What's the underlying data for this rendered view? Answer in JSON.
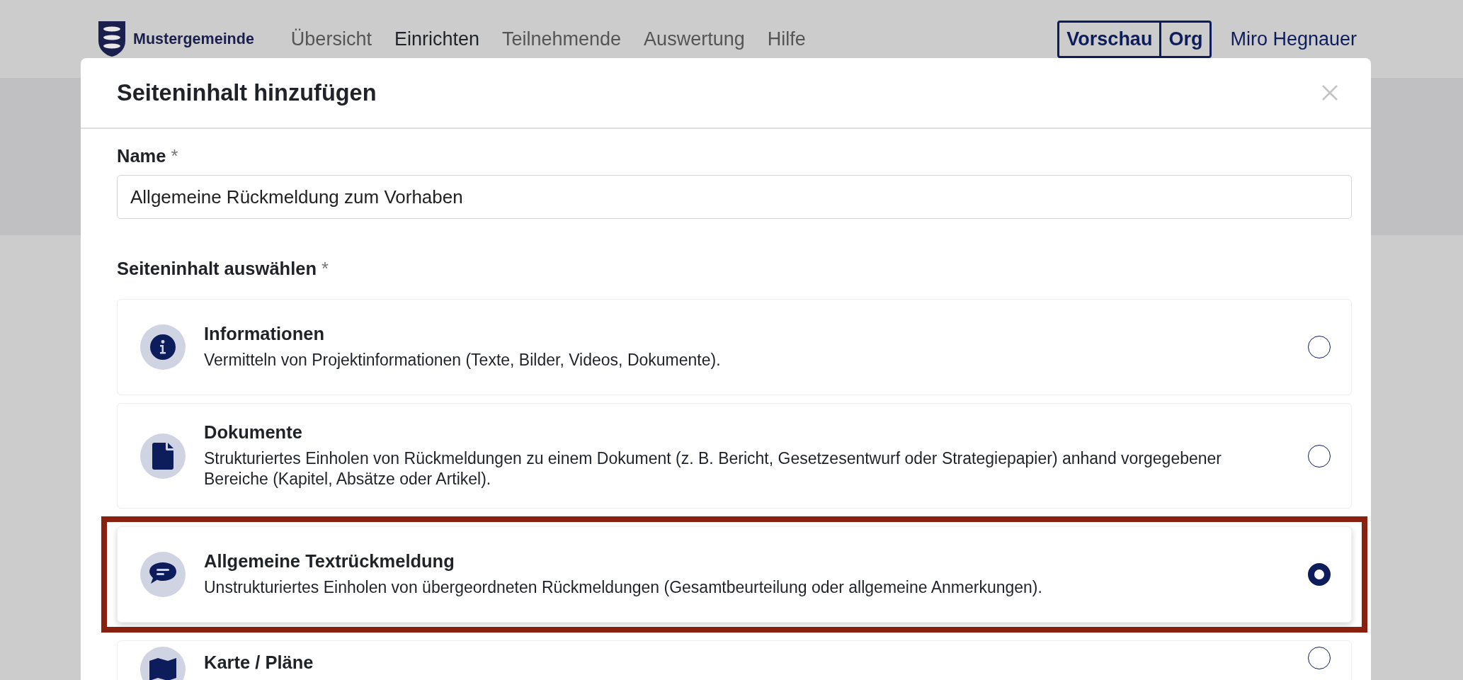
{
  "header": {
    "logo_text": "Mustergemeinde",
    "nav": [
      {
        "label": "Übersicht",
        "selected": false
      },
      {
        "label": "Einrichten",
        "selected": true
      },
      {
        "label": "Teilnehmende",
        "selected": false
      },
      {
        "label": "Auswertung",
        "selected": false
      },
      {
        "label": "Hilfe",
        "selected": false
      }
    ],
    "toggle": [
      {
        "label": "Vorschau"
      },
      {
        "label": "Org"
      }
    ],
    "user": "Miro Hegnauer"
  },
  "dialog": {
    "title": "Seiteninhalt hinzufügen",
    "name_label": "Name",
    "name_required": "*",
    "name_value": "Allgemeine Rückmeldung zum Vorhaben",
    "content_label": "Seiteninhalt auswählen",
    "content_required": "*",
    "options": [
      {
        "kind": "info",
        "title": "Informationen",
        "description": "Vermitteln von Projektinformationen (Texte, Bilder, Videos, Dokumente).",
        "selected": false,
        "highlighted": false
      },
      {
        "kind": "document",
        "title": "Dokumente",
        "description": "Strukturiertes Einholen von Rückmeldungen zu einem Dokument (z. B. Bericht, Gesetzesentwurf oder Strategiepapier) anhand vorgegebener Bereiche (Kapitel, Absätze oder Artikel).",
        "selected": false,
        "highlighted": false
      },
      {
        "kind": "comment",
        "title": "Allgemeine Textrückmeldung",
        "description": "Unstrukturiertes Einholen von übergeordneten Rückmeldungen (Gesamtbeurteilung oder allgemeine Anmerkungen).",
        "selected": true,
        "highlighted": true
      },
      {
        "kind": "map",
        "title": "Karte / Pläne",
        "selected": false,
        "highlighted": false
      }
    ]
  }
}
